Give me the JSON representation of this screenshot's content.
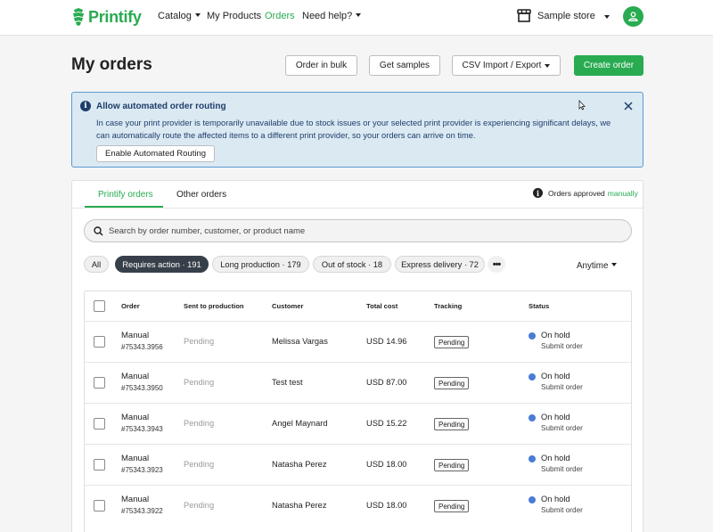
{
  "app": {
    "brand": "Printify",
    "brand_color": "#29ab51"
  },
  "nav": {
    "catalog": "Catalog",
    "my_products": "My Products",
    "orders": "Orders",
    "need_help": "Need help?",
    "store_name": "Sample store"
  },
  "header": {
    "title": "My orders",
    "order_in_bulk": "Order in bulk",
    "get_samples": "Get samples",
    "csv_import_export": "CSV Import / Export",
    "create_order": "Create order"
  },
  "banner": {
    "title": "Allow automated order routing",
    "body": "In case your print provider is temporarily unavailable due to stock issues or your selected print provider is experiencing significant delays, we can automatically route the affected items to a different print provider, so your orders can arrive on time.",
    "button": "Enable Automated Routing"
  },
  "tabs": {
    "printify_orders": "Printify orders",
    "other_orders": "Other orders"
  },
  "approved": {
    "text": "Orders approved",
    "mode": "manually"
  },
  "search": {
    "placeholder": "Search by order number, customer, or product name"
  },
  "filters": {
    "all": "All",
    "requires_action": "Requires action · 191",
    "long_production": "Long production · 179",
    "out_of_stock": "Out of stock · 18",
    "express_delivery": "Express delivery · 72",
    "date_range": "Anytime"
  },
  "table": {
    "headers": {
      "order": "Order",
      "sent_to_production": "Sent to production",
      "customer": "Customer",
      "total_cost": "Total cost",
      "tracking": "Tracking",
      "status": "Status"
    },
    "rows": [
      {
        "type": "Manual",
        "number": "#75343.3956",
        "sent": "Pending",
        "customer": "Melissa Vargas",
        "total": "USD 14.96",
        "tracking": "Pending",
        "status": "On hold",
        "status_action": "Submit order"
      },
      {
        "type": "Manual",
        "number": "#75343.3950",
        "sent": "Pending",
        "customer": "Test test",
        "total": "USD 87.00",
        "tracking": "Pending",
        "status": "On hold",
        "status_action": "Submit order"
      },
      {
        "type": "Manual",
        "number": "#75343.3943",
        "sent": "Pending",
        "customer": "Angel Maynard",
        "total": "USD 15.22",
        "tracking": "Pending",
        "status": "On hold",
        "status_action": "Submit order"
      },
      {
        "type": "Manual",
        "number": "#75343.3923",
        "sent": "Pending",
        "customer": "Natasha Perez",
        "total": "USD 18.00",
        "tracking": "Pending",
        "status": "On hold",
        "status_action": "Submit order"
      },
      {
        "type": "Manual",
        "number": "#75343.3922",
        "sent": "Pending",
        "customer": "Natasha Perez",
        "total": "USD 18.00",
        "tracking": "Pending",
        "status": "On hold",
        "status_action": "Submit order"
      }
    ]
  }
}
